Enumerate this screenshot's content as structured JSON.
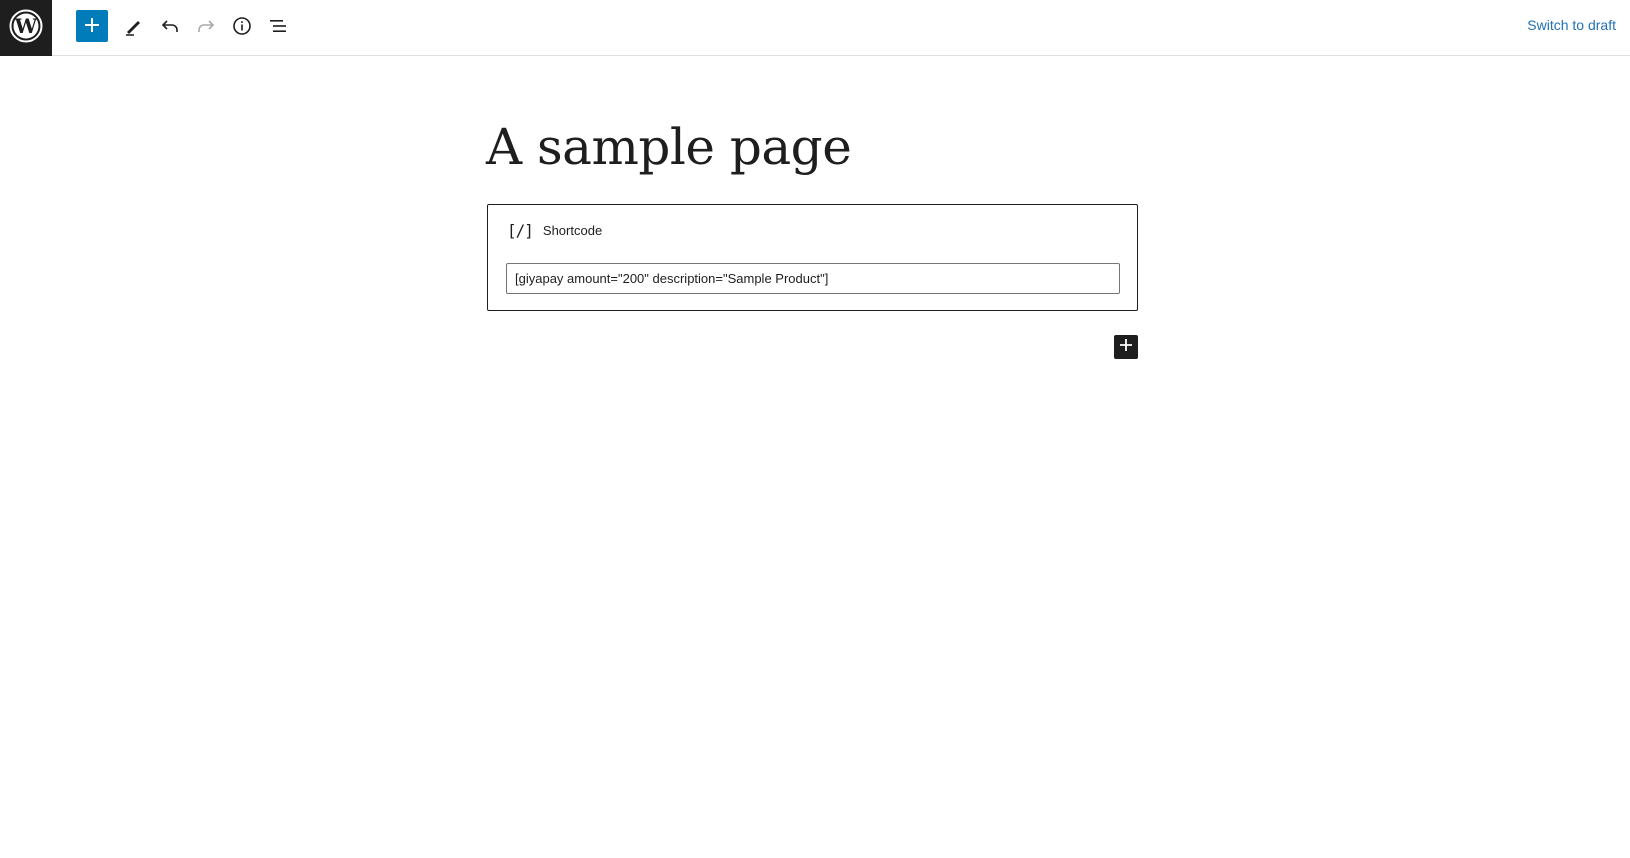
{
  "header": {
    "logo_icon": "wordpress-logo-icon",
    "tools": [
      {
        "name": "add-block-button",
        "icon": "plus-icon"
      },
      {
        "name": "tools-button",
        "icon": "pencil-icon"
      },
      {
        "name": "undo-button",
        "icon": "undo-icon"
      },
      {
        "name": "redo-button",
        "icon": "redo-icon"
      },
      {
        "name": "details-button",
        "icon": "info-icon"
      },
      {
        "name": "document-overview-button",
        "icon": "list-view-icon"
      }
    ],
    "switch_to_draft": "Switch to draft",
    "accent_color": "#007cba",
    "link_color": "#2271b1"
  },
  "editor": {
    "page_title": "A sample page",
    "shortcode_block": {
      "icon": "[/]",
      "label": "Shortcode",
      "value": "[giyapay amount=\"200\" description=\"Sample Product\"]"
    },
    "inserter_icon": "plus-icon"
  }
}
